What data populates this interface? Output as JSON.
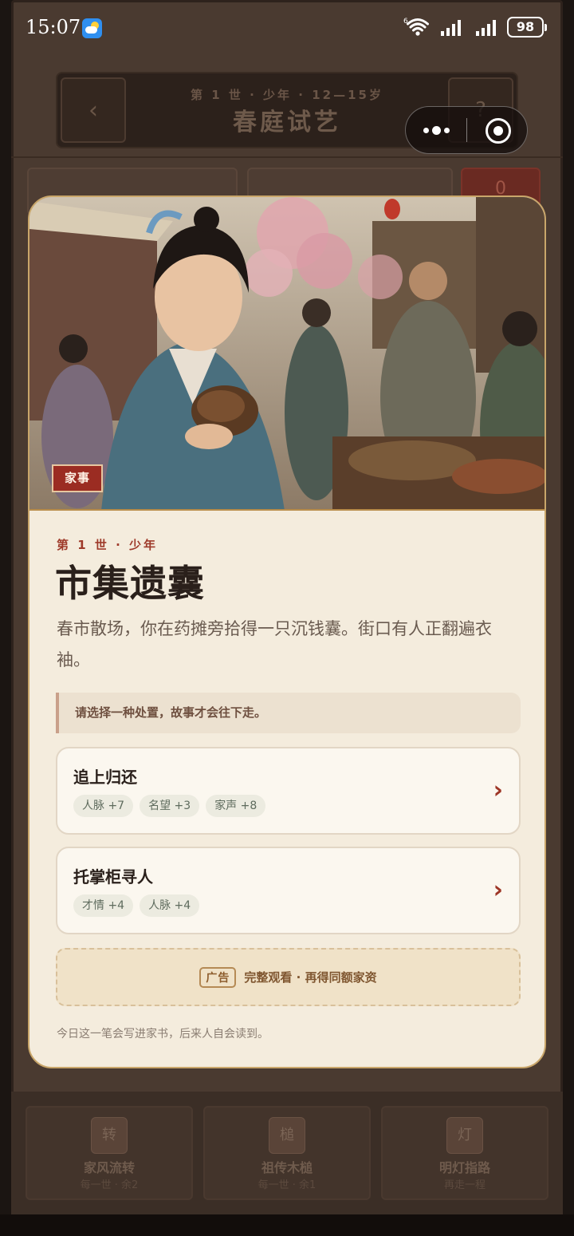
{
  "status_bar": {
    "time": "15:07",
    "battery": "98",
    "icons": [
      "weather-icon",
      "wifi-6-icon",
      "signal-icon",
      "signal-icon",
      "battery-icon"
    ]
  },
  "background_screen": {
    "subtitle": "第 1 世 · 少年 · 12—15岁",
    "title": "春庭试艺",
    "back_label": "‹",
    "help_label": "?",
    "red_card_value": "0",
    "tools": [
      {
        "glyph": "转",
        "name": "家风流转",
        "sub": "每一世 · 余2"
      },
      {
        "glyph": "槌",
        "name": "祖传木槌",
        "sub": "每一世 · 余1"
      },
      {
        "glyph": "灯",
        "name": "明灯指路",
        "sub": "再走一程"
      }
    ]
  },
  "capsule": {
    "icons": [
      "more-dots-icon",
      "close-target-icon"
    ]
  },
  "modal": {
    "tag": "家事",
    "life_stage": "第 1 世 · 少年",
    "title": "市集遗囊",
    "description": "春市散场，你在药摊旁拾得一只沉钱囊。街口有人正翻遍衣袖。",
    "hint": "请选择一种处置，故事才会往下走。",
    "choices": [
      {
        "label": "追上归还",
        "effects": [
          "人脉 +7",
          "名望 +3",
          "家声 +8"
        ]
      },
      {
        "label": "托掌柜寻人",
        "effects": [
          "才情 +4",
          "人脉 +4"
        ]
      }
    ],
    "ad": {
      "badge": "广告",
      "text": "完整观看 · 再得同额家资"
    },
    "footnote": "今日这一笔会写进家书，后来人自会读到。",
    "accent_color": "#9b2c22",
    "chevron": "›"
  }
}
